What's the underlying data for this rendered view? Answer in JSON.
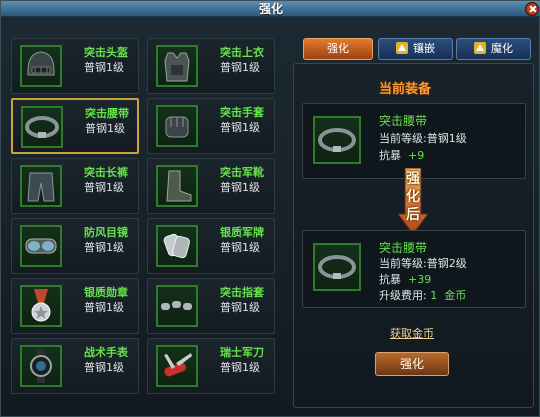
{
  "window": {
    "title": "强化"
  },
  "tabs": [
    {
      "label": "强化",
      "active": true
    },
    {
      "label": "镶嵌",
      "active": false
    },
    {
      "label": "魔化",
      "active": false
    }
  ],
  "equipment_list": [
    {
      "name": "突击头盔",
      "level": "普钢1级",
      "icon": "helmet-icon"
    },
    {
      "name": "突击上衣",
      "level": "普钢1级",
      "icon": "armor-vest-icon"
    },
    {
      "name": "突击腰带",
      "level": "普钢1级",
      "icon": "belt-icon",
      "selected": true
    },
    {
      "name": "突击手套",
      "level": "普钢1级",
      "icon": "gloves-icon"
    },
    {
      "name": "突击长裤",
      "level": "普钢1级",
      "icon": "pants-icon"
    },
    {
      "name": "突击军靴",
      "level": "普钢1级",
      "icon": "boots-icon"
    },
    {
      "name": "防风目镜",
      "level": "普钢1级",
      "icon": "goggles-icon"
    },
    {
      "name": "银质军牌",
      "level": "普钢1级",
      "icon": "dog-tags-icon"
    },
    {
      "name": "银质勋章",
      "level": "普钢1级",
      "icon": "medal-icon"
    },
    {
      "name": "突击指套",
      "level": "普钢1级",
      "icon": "finger-guards-icon"
    },
    {
      "name": "战术手表",
      "level": "普钢1级",
      "icon": "watch-icon"
    },
    {
      "name": "瑞士军刀",
      "level": "普钢1级",
      "icon": "swiss-knife-icon"
    }
  ],
  "current_equipment": {
    "header": "当前装备",
    "name": "突击腰带",
    "level_label": "当前等级:",
    "level_value": "普钢1级",
    "stat_label": "抗暴",
    "stat_value": "+9"
  },
  "arrow_label": [
    "强",
    "化",
    "后"
  ],
  "upgraded_equipment": {
    "name": "突击腰带",
    "level_label": "当前等级:",
    "level_value": "普钢2级",
    "stat_label": "抗暴",
    "stat_value": "+39",
    "cost_label": "升级费用:",
    "cost_value": "1",
    "cost_unit": "金币"
  },
  "get_gold_link": "获取金币",
  "strengthen_button": "强化",
  "colors": {
    "item_name": "#66e24b",
    "header": "#ff9a2e",
    "selected_border": "#c9a53a"
  }
}
